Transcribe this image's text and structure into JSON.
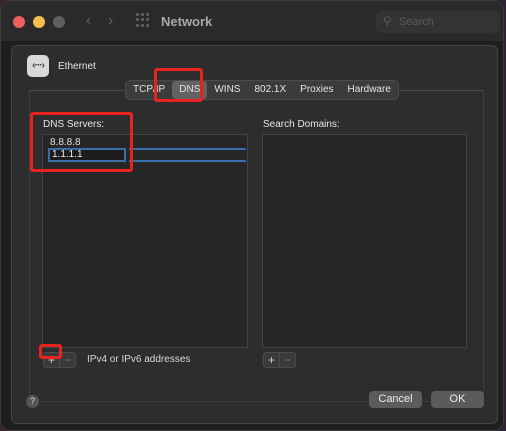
{
  "window": {
    "title": "Network",
    "search_placeholder": "Search",
    "back_glyph": "‹",
    "forward_glyph": "›",
    "traffic_light_colors": [
      "#ec5f5a",
      "#f4bf4f",
      "#5f5f5f"
    ]
  },
  "service": {
    "icon_glyph": "‹···›",
    "name": "Ethernet"
  },
  "tabs": [
    {
      "label": "TCP/IP",
      "selected": false
    },
    {
      "label": "DNS",
      "selected": true
    },
    {
      "label": "WINS",
      "selected": false
    },
    {
      "label": "802.1X",
      "selected": false
    },
    {
      "label": "Proxies",
      "selected": false
    },
    {
      "label": "Hardware",
      "selected": false
    }
  ],
  "dns": {
    "label": "DNS Servers:",
    "servers": [
      "8.8.8.8",
      "1.1.1.1"
    ],
    "add_label": "+",
    "remove_label": "−",
    "hint": "IPv4 or IPv6 addresses"
  },
  "search_domains": {
    "label": "Search Domains:",
    "add_label": "+",
    "remove_label": "−"
  },
  "footer": {
    "help_label": "?",
    "cancel_label": "Cancel",
    "ok_label": "OK"
  },
  "highlight_color": "#e8231f",
  "accent_color": "#3a6ea8"
}
